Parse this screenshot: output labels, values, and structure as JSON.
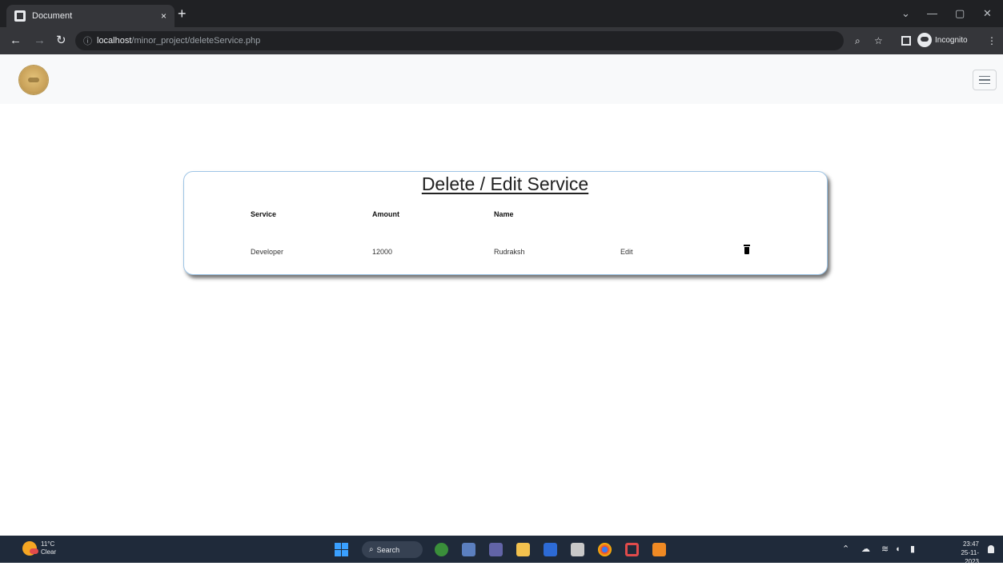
{
  "browser": {
    "tab_title": "Document",
    "tab_close": "×",
    "new_tab": "+",
    "url_host": "localhost",
    "url_path": "/minor_project/deleteService.php",
    "window_controls": {
      "minimize": "—",
      "maximize": "▢",
      "close": "✕",
      "tabsearch": "⌄"
    },
    "profile_label": "Incognito",
    "menu": "⋮",
    "zoom": "🔍",
    "bookmark": "☆"
  },
  "page": {
    "title": "Delete / Edit Service",
    "table": {
      "headers": [
        "Service",
        "Amount",
        "Name"
      ],
      "rows": [
        {
          "service": "Developer",
          "amount": "12000",
          "name": "Rudraksh",
          "edit": "Edit"
        }
      ]
    }
  },
  "taskbar": {
    "weather_temp": "11°C",
    "weather_cond": "Clear",
    "search_label": "Search",
    "clock_time": "23:47",
    "clock_date": "25-11-2023"
  },
  "colors": {
    "titlebar": "#202124",
    "toolbar": "#35363a",
    "card_border": "#9ec5e6",
    "taskbar": "#1f2a3a"
  },
  "icons": [
    "back-icon",
    "forward-icon",
    "reload-icon",
    "info-icon",
    "zoom-icon",
    "bookmark-icon",
    "sidepanel-icon",
    "incognito-icon",
    "menu-icon",
    "hamburger-icon",
    "trash-icon",
    "windows-start-icon",
    "search-icon"
  ]
}
